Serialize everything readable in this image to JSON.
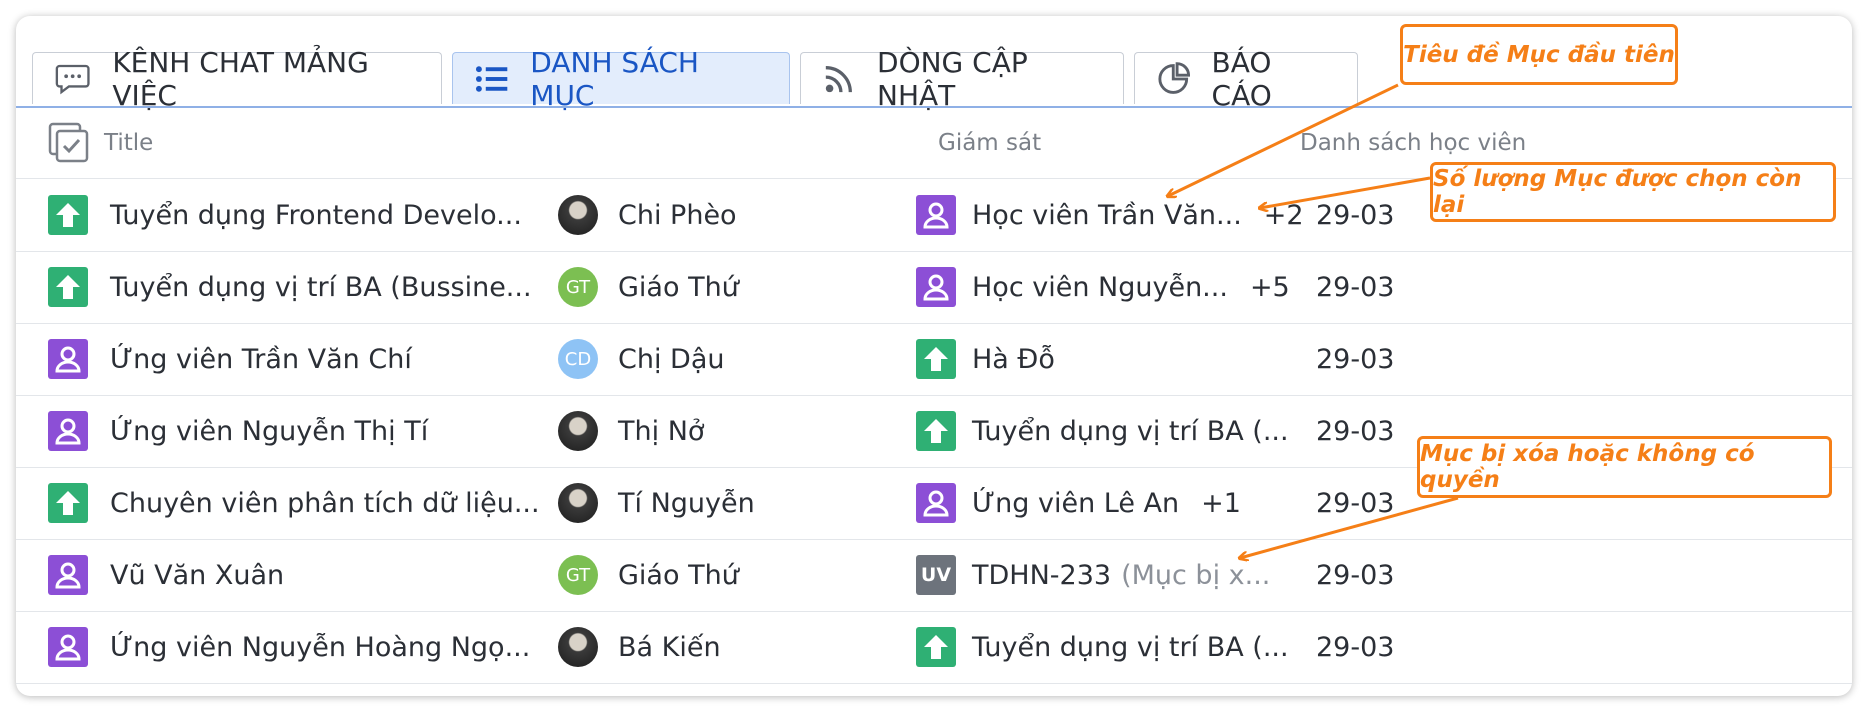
{
  "tabs": [
    {
      "label": "KÊNH CHAT MẢNG VIỆC",
      "icon": "chat-icon"
    },
    {
      "label": "DANH SÁCH MỤC",
      "icon": "list-icon",
      "active": true
    },
    {
      "label": "DÒNG CẬP NHẬT",
      "icon": "feed-icon"
    },
    {
      "label": "BÁO CÁO",
      "icon": "pie-chart-icon"
    }
  ],
  "header": {
    "title": "Title",
    "supervisor": "Giám sát",
    "students": "Danh sách học viên"
  },
  "rows": [
    {
      "title": "Tuyển dụng Frontend Develo...",
      "title_icon": "upload-arrow-icon",
      "person": "Chi Phèo",
      "linked": "Học viên Trần Văn...",
      "linked_icon": "user-icon",
      "extra": "+2",
      "date": "29-03"
    },
    {
      "title": "Tuyển dụng vị trí BA (Bussine...",
      "title_icon": "upload-arrow-icon",
      "person": "Giáo Thứ",
      "person_initials": "GT",
      "linked": "Học viên Nguyễn...",
      "linked_icon": "user-icon",
      "extra": "+5",
      "date": "29-03"
    },
    {
      "title": "Ứng viên Trần Văn Chí",
      "title_icon": "user-icon",
      "person": "Chị Dậu",
      "person_initials": "CD",
      "linked": "Hà Đỗ",
      "linked_icon": "upload-arrow-icon",
      "extra": "",
      "date": "29-03"
    },
    {
      "title": "Ứng viên Nguyễn Thị Tí",
      "title_icon": "user-icon",
      "person": "Thị Nở",
      "linked": "Tuyển dụng vị trí BA (...",
      "linked_icon": "upload-arrow-icon",
      "extra": "",
      "date": "29-03"
    },
    {
      "title": "Chuyên viên phân tích dữ liệu...",
      "title_icon": "upload-arrow-icon",
      "person": "Tí Nguyễn",
      "linked": "Ứng viên Lê An",
      "linked_icon": "user-icon",
      "extra": "+1",
      "date": "29-03"
    },
    {
      "title": "Vũ Văn Xuân",
      "title_icon": "user-icon",
      "person": "Giáo Thứ",
      "person_initials": "GT",
      "linked": "TDHN-233",
      "linked_muted": "(Mục bị x...",
      "linked_icon": "uv-badge-icon",
      "linked_badge": "UV",
      "extra": "",
      "date": "29-03"
    },
    {
      "title": "Ứng viên Nguyễn Hoàng Ngọ...",
      "title_icon": "user-icon",
      "person": "Bá Kiến",
      "linked": "Tuyển dụng vị trí BA (...",
      "linked_icon": "upload-arrow-icon",
      "extra": "",
      "date": "29-03"
    }
  ],
  "callouts": {
    "first_title": "Tiêu đề Mục đầu tiên",
    "remaining_count": "Số lượng Mục được chọn còn lại",
    "deleted": "Mục bị xóa hoặc không có quyền"
  },
  "colors": {
    "accent": "#f57f17",
    "active_tab": "#1a56c4",
    "green_icon": "#2fb074",
    "purple_icon": "#8c4fd6"
  }
}
